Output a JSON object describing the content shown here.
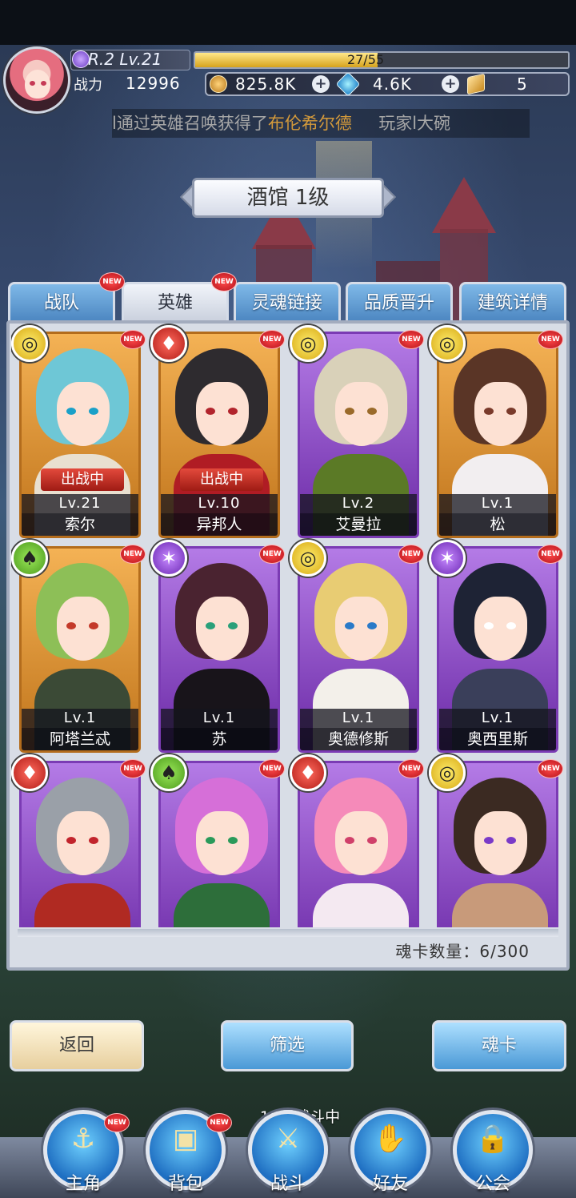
{
  "player": {
    "rank_level": "R.2 Lv.21",
    "exp": "27/55",
    "exp_fraction": 0.49,
    "power_label": "战力",
    "power_value": "12996"
  },
  "resources": {
    "gold": "825.8K",
    "gems": "4.6K",
    "tickets": "5"
  },
  "marquee": {
    "prefix": "l通过英雄召唤获得了",
    "highlight": "布伦希尔德",
    "suffix": "     玩家l大碗"
  },
  "title": "酒馆 1级",
  "tabs": [
    {
      "label": "战队",
      "new": "NEW"
    },
    {
      "label": "英雄",
      "new": "NEW"
    },
    {
      "label": "灵魂链接"
    },
    {
      "label": "品质晋升"
    },
    {
      "label": "建筑详情"
    }
  ],
  "heroes": [
    {
      "name": "索尔",
      "level": "Lv.21",
      "status": "出战中",
      "new": "NEW",
      "element": "yellow",
      "frame": "orange",
      "hair": "#6ec7d6",
      "outfit": "#e9e0d0",
      "eye": "#1aa0c8"
    },
    {
      "name": "异邦人",
      "level": "Lv.10",
      "status": "出战中",
      "new": "NEW",
      "element": "red",
      "frame": "orange",
      "hair": "#2e2b2f",
      "outfit": "#b01c24",
      "eye": "#b2242c"
    },
    {
      "name": "艾曼拉",
      "level": "Lv.2",
      "new": "NEW",
      "element": "yellow",
      "frame": "purple",
      "hair": "#d9d1b9",
      "outfit": "#5b7a26",
      "eye": "#9a6a2a"
    },
    {
      "name": "松",
      "level": "Lv.1",
      "new": "NEW",
      "element": "yellow",
      "frame": "orange",
      "hair": "#5a3526",
      "outfit": "#f2eef0",
      "eye": "#7a3a2a"
    },
    {
      "name": "阿塔兰忒",
      "level": "Lv.1",
      "new": "NEW",
      "element": "green",
      "frame": "orange",
      "hair": "#8dbf57",
      "outfit": "#3b4a36",
      "eye": "#c43a2a"
    },
    {
      "name": "苏",
      "level": "Lv.1",
      "new": "NEW",
      "element": "purple",
      "frame": "purple",
      "hair": "#4a2330",
      "outfit": "#18141a",
      "eye": "#2aa07a"
    },
    {
      "name": "奥德修斯",
      "level": "Lv.1",
      "new": "NEW",
      "element": "yellow",
      "frame": "purple",
      "hair": "#e8cc73",
      "outfit": "#f3f0ea",
      "eye": "#2a7ac8"
    },
    {
      "name": "奥西里斯",
      "level": "Lv.1",
      "new": "NEW",
      "element": "purple",
      "frame": "purple",
      "hair": "#1e2335",
      "outfit": "#3a3f5a",
      "eye": "#ffffff"
    },
    {
      "name": "",
      "level": "",
      "new": "NEW",
      "element": "red",
      "frame": "purple",
      "hair": "#9aa0a8",
      "outfit": "#b02a22",
      "eye": "#c2242c"
    },
    {
      "name": "",
      "level": "",
      "new": "NEW",
      "element": "green",
      "frame": "purple",
      "hair": "#d66fd8",
      "outfit": "#2d6e3a",
      "eye": "#2a9a5a"
    },
    {
      "name": "",
      "level": "",
      "new": "NEW",
      "element": "red",
      "frame": "purple",
      "hair": "#f58ab9",
      "outfit": "#f4e9f1",
      "eye": "#d0406a"
    },
    {
      "name": "",
      "level": "",
      "new": "NEW",
      "element": "yellow",
      "frame": "purple",
      "hair": "#3b2a22",
      "outfit": "#c89a7a",
      "eye": "#7a3ac8"
    }
  ],
  "soul_card_count": "魂卡数量：6/300",
  "buttons": {
    "back": "返回",
    "filter": "筛选",
    "soul_card": "魂卡"
  },
  "battle_status": "15层战斗中",
  "nav": [
    {
      "label": "主角",
      "new": "NEW",
      "icon": "helmet-icon"
    },
    {
      "label": "背包",
      "new": "NEW",
      "icon": "backpack-icon"
    },
    {
      "label": "战斗",
      "icon": "crossed-swords-icon"
    },
    {
      "label": "好友",
      "icon": "handshake-icon"
    },
    {
      "label": "公会",
      "icon": "lock-icon"
    }
  ]
}
